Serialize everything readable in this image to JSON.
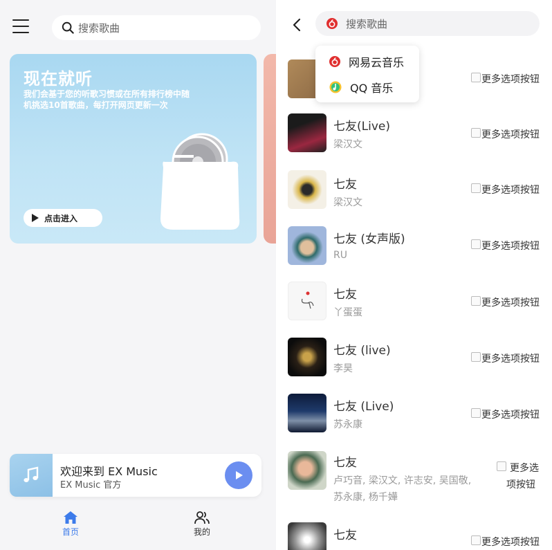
{
  "left": {
    "search": {
      "placeholder": "搜索歌曲"
    },
    "banner": {
      "title": "现在就听",
      "description": "我们会基于您的听歌习惯或在所有排行榜中随机挑选10首歌曲，每打开网页更新一次",
      "button": "点击进入"
    },
    "player": {
      "title": "欢迎来到 EX Music",
      "subtitle": "EX Music 官方"
    },
    "tabs": [
      {
        "label": "首页"
      },
      {
        "label": "我的"
      }
    ],
    "colors": {
      "accent": "#3d7bea",
      "play": "#6b8ef0",
      "banner": "#bfe3f5"
    }
  },
  "right": {
    "search": {
      "placeholder": "搜索歌曲"
    },
    "sources": [
      {
        "label": "网易云音乐",
        "icon": "netease-icon"
      },
      {
        "label": "QQ 音乐",
        "icon": "qq-music-icon"
      }
    ],
    "more_label": "更多选项按钮",
    "songs": [
      {
        "title": "",
        "artist": ""
      },
      {
        "title": "七友(Live)",
        "artist": "梁汉文"
      },
      {
        "title": "七友",
        "artist": "梁汉文"
      },
      {
        "title": "七友 (女声版)",
        "artist": "RU"
      },
      {
        "title": "七友",
        "artist": "丫蛋蛋"
      },
      {
        "title": "七友 (live)",
        "artist": "李昊"
      },
      {
        "title": "七友 (Live)",
        "artist": "苏永康"
      },
      {
        "title": "七友",
        "artist_line1": "卢巧音, 梁汉文, 许志安, 吴国敬,",
        "artist_line2": "苏永康, 杨千嬅",
        "more_line1": "更多选",
        "more_line2": "项按钮"
      },
      {
        "title": "七友",
        "artist": ""
      }
    ]
  }
}
